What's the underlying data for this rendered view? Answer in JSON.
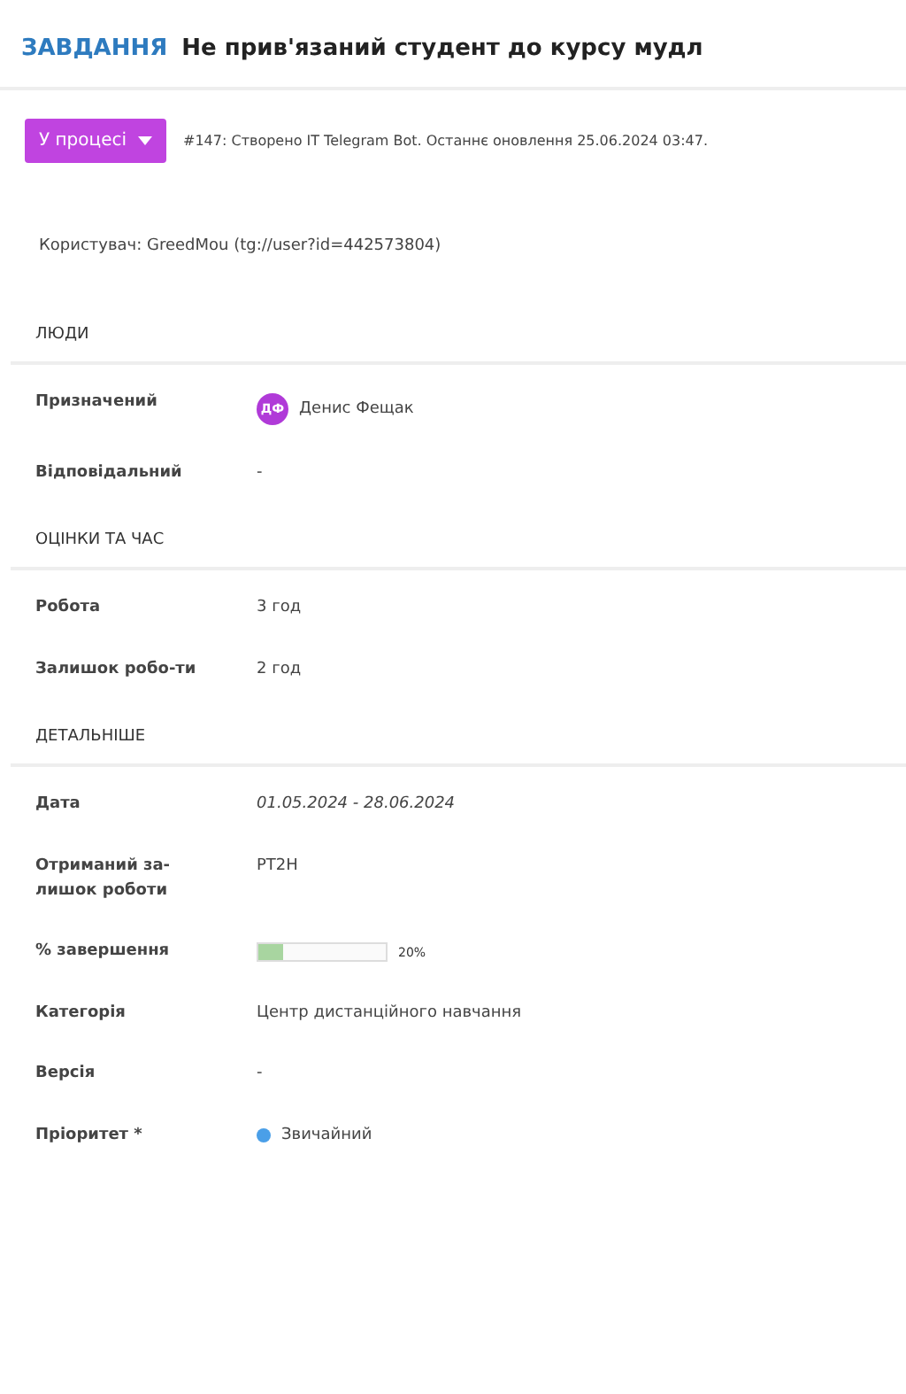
{
  "header": {
    "kind_label": "ЗАВДАННЯ",
    "title": "Не прив'язаний студент до курсу мудл"
  },
  "status": {
    "label": "У процесі",
    "info": "#147: Створено IT Telegram Bot. Останнє оновлення 25.06.2024 03:47."
  },
  "description": "Користувач: GreedMou (tg://user?id=442573804)",
  "sections": [
    {
      "title": "ЛЮДИ",
      "rows": [
        {
          "kind": "avatar",
          "label": "Призначений",
          "initials": "ДФ",
          "value": "Денис Фещак"
        },
        {
          "kind": "text",
          "label": "Відповідальний",
          "value": "-"
        }
      ]
    },
    {
      "title": "ОЦІНКИ ТА ЧАС",
      "rows": [
        {
          "kind": "text",
          "label": "Робота",
          "value": "3 год"
        },
        {
          "kind": "text",
          "label": "Залишок робо-ти",
          "value": "2 год"
        }
      ]
    },
    {
      "title": "ДЕТАЛЬНІШЕ",
      "rows": [
        {
          "kind": "italic",
          "label": "Дата",
          "value": "01.05.2024 - 28.06.2024"
        },
        {
          "kind": "text",
          "label": "Отриманий за-лишок роботи",
          "value": "PT2H"
        },
        {
          "kind": "progress",
          "label": "% завершення",
          "level": 0.2,
          "reading": "20%"
        },
        {
          "kind": "text",
          "label": "Категорія",
          "value": "Центр дистанційного навчання"
        },
        {
          "kind": "text",
          "label": "Версія",
          "value": "-"
        },
        {
          "kind": "dot",
          "label": "Пріоритет *",
          "color": "#4a9fe8",
          "value": "Звичайний"
        }
      ]
    }
  ]
}
